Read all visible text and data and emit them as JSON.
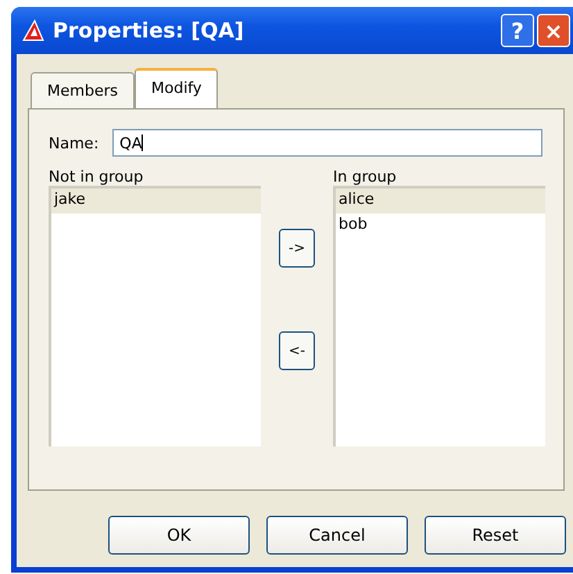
{
  "window": {
    "title": "Properties: [QA]"
  },
  "title_buttons": [
    {
      "kind": "help",
      "label": "?"
    },
    {
      "kind": "close",
      "label": "×"
    }
  ],
  "tabs": [
    {
      "label": "Members",
      "selected": false
    },
    {
      "label": "Modify",
      "selected": true
    }
  ],
  "name_field": {
    "label": "Name:",
    "value": "QA"
  },
  "not_in_group": {
    "label": "Not in group",
    "items": [
      {
        "label": "jake",
        "selected": true
      }
    ]
  },
  "move_buttons": [
    {
      "label": "->"
    },
    {
      "label": "<-"
    }
  ],
  "in_group": {
    "label": "In group",
    "items": [
      {
        "label": "alice",
        "selected": true
      },
      {
        "label": "bob",
        "selected": false
      }
    ]
  },
  "buttons": [
    "OK",
    "Cancel",
    "Reset"
  ]
}
